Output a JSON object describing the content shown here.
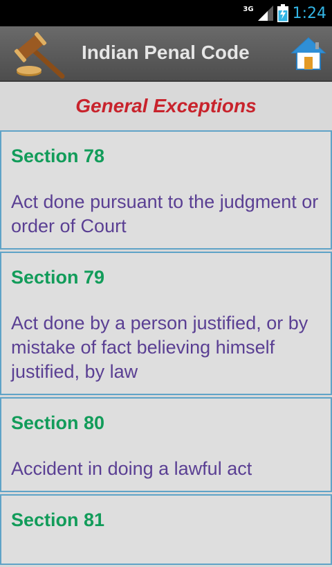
{
  "status_bar": {
    "network_label": "3G",
    "time": "1:24",
    "icons": [
      "signal-icon",
      "battery-charging-icon"
    ]
  },
  "header": {
    "title": "Indian Penal Code",
    "logo_icon": "gavel-icon",
    "home_icon": "home-icon"
  },
  "page": {
    "title": "General Exceptions"
  },
  "sections": [
    {
      "title": "Section 78",
      "description": "Act done pursuant to the judgment or order of Court"
    },
    {
      "title": "Section 79",
      "description": "Act done by a person justified, or by mistake of fact believing himself justified, by law"
    },
    {
      "title": "Section 80",
      "description": "Accident in doing a lawful act"
    },
    {
      "title": "Section 81",
      "description": ""
    }
  ],
  "colors": {
    "title_red": "#c8232c",
    "section_green": "#129c5a",
    "desc_purple": "#5a3f93",
    "card_border": "#5fa3c7",
    "status_blue": "#33b5e5"
  }
}
